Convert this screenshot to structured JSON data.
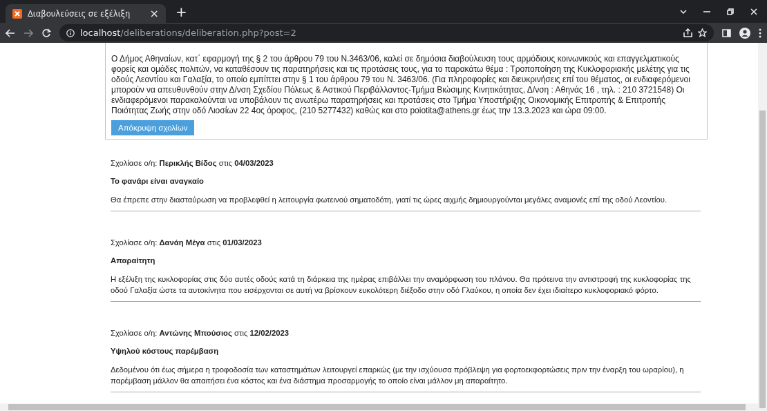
{
  "browser": {
    "tab": {
      "title": "Διαβουλεύσεις σε εξέλιξη",
      "close": "×"
    },
    "new_tab": "+",
    "url": {
      "host": "localhost",
      "path": "/deliberations/deliberation.php?post=2"
    }
  },
  "deliberation": {
    "text": "Ο Δήμος Αθηναίων, κατ΄ εφαρμογή της § 2 του άρθρου 79 του Ν.3463/06, καλεί σε δημόσια διαβούλευση τους αρμόδιους κοινωνικούς και επαγγελματικούς φορείς και ομάδες πολιτών, να καταθέσουν τις παρατηρήσεις και τις προτάσεις τους, για το παρακάτω θέμα : Τροποποίηση της Κυκλοφοριακής μελέτης για τις οδούς Λεοντίου και Γαλαξία, το οποίο εμπίπτει στην § 1 του άρθρου 79 του Ν. 3463/06. (Για πληροφορίες και διευκρινήσεις επί του θέματος, οι ενδιαφερόμενοι μπορούν να απευθυνθούν στην Δ/νση Σχεδίου Πόλεως & Αστικού Περιβάλλοντος-Τμήμα Βιώσιμης Κινητικότητας, Δ/νση : Αθηνάς 16 , τηλ. : 210 3721548) Οι ενδιαφερόμενοι παρακαλούνται να υποβάλουν τις ανωτέρω παρατηρήσεις και προτάσεις στο Τμήμα Υποστήριξης Οικονομικής Επιτροπής & Επιτροπής Ποιότητας Ζωής στην οδό Λιοσίων 22 4ος όροφος, (210 5277432) καθώς και στο poiotita@athens.gr έως την 13.3.2023 και ώρα 09:00.",
    "button": "Απόκρυψη σχολίων"
  },
  "comments": [
    {
      "byline": "Σχολίασε ο/η: **Περικλής Βίδος** στις **04/03/2023**",
      "title": "Το φανάρι είναι αναγκαίο",
      "body": "Θα έπρεπε στην διασταύρωση να προβλεφθεί η λειτουργία φωτεινού σηματοδότη, γιατί τις ώρες αιχμής δημιουργούνται μεγάλες αναμονές επί της οδού Λεοντίου."
    },
    {
      "byline": "Σχολίασε ο/η: **Δανάη Μέγα** στις **01/03/2023**",
      "title": "Απαραίτητη",
      "body": "Η εξέλιξη της κυκλοφορίας στις δύο αυτές οδούς κατά τη διάρκεια της ημέρας επιβάλλει την αναμόρφωση του πλάνου. Θα πρότεινα την αντιστροφή της κυκλοφορίας της οδού Γαλαξία ώστε τα αυτοκίνητα που εισέρχονται σε αυτή να βρίσκουν ευκολότερη διέξοδο στην οδό Γλαύκου, η οποία δεν έχει ιδιαίτερο κυκλοφοριακό φόρτο."
    },
    {
      "byline": "Σχολίασε ο/η: **Αντώνης Μπούσιος** στις **12/02/2023**",
      "title": "Υψηλού κόστους παρέμβαση",
      "body": "Δεδομένου ότι έως σήμερα η τροφοδοσία των καταστημάτων λειτουργεί επαρκώς (με την ισχύουσα πρόβλεψη για φορτοεκφορτώσεις πριν την έναρξη του ωραρίου), η παρέμβαση μάλλον θα απαιτήσει ένα κόστος και ένα διάστημα προσαρμογής το οποίο είναι μάλλον μη απαραίτητο."
    }
  ]
}
